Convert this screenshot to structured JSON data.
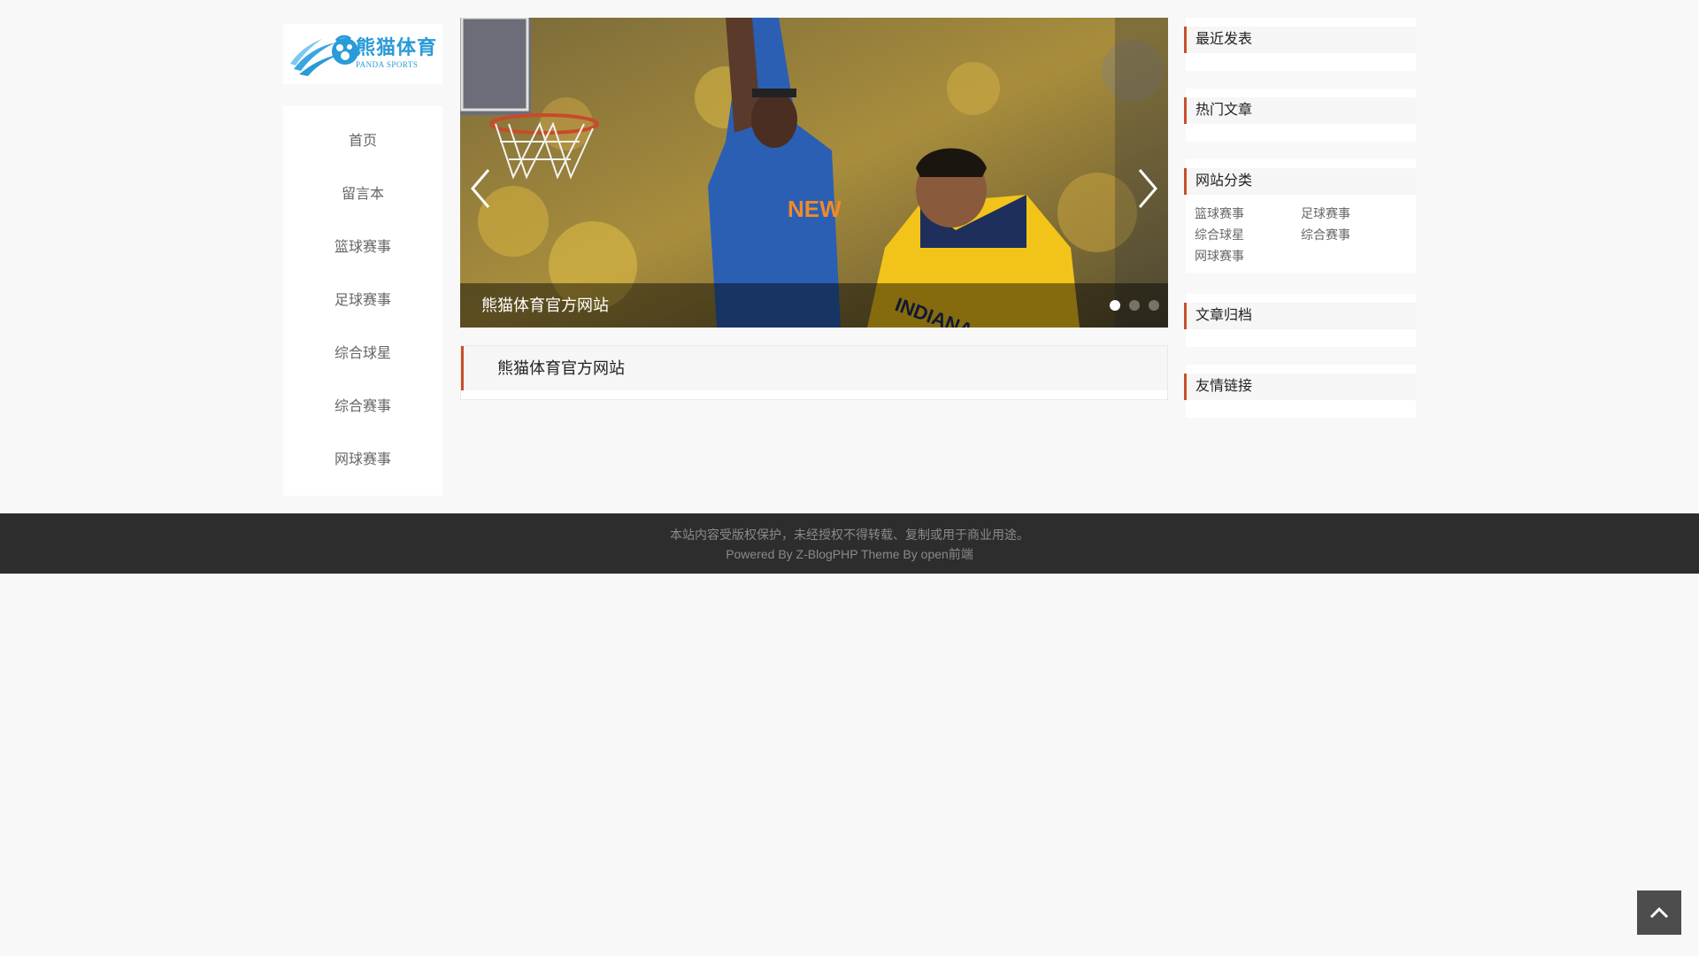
{
  "logo": {
    "text_cn": "熊猫体育",
    "text_en": "PANDA SPORTS",
    "brand_color": "#2a9ad8"
  },
  "nav": {
    "items": [
      {
        "label": "首页"
      },
      {
        "label": "留言本"
      },
      {
        "label": "篮球赛事"
      },
      {
        "label": "足球赛事"
      },
      {
        "label": "综合球星"
      },
      {
        "label": "综合赛事"
      },
      {
        "label": "网球赛事"
      }
    ]
  },
  "slider": {
    "caption": "熊猫体育官方网站",
    "prev_icon": "chevron-left-icon",
    "next_icon": "chevron-right-icon",
    "dots": 3,
    "active_dot": 1
  },
  "article": {
    "title": "熊猫体育官方网站"
  },
  "sidebar": {
    "accent_color": "#c6502b",
    "recent": {
      "title": "最近发表"
    },
    "hot": {
      "title": "热门文章"
    },
    "categories": {
      "title": "网站分类",
      "items": [
        {
          "label": "篮球赛事"
        },
        {
          "label": "足球赛事"
        },
        {
          "label": "综合球星"
        },
        {
          "label": "综合赛事"
        },
        {
          "label": "网球赛事"
        }
      ]
    },
    "archive": {
      "title": "文章归档"
    },
    "links": {
      "title": "友情链接"
    }
  },
  "footer": {
    "line1": "本站内容受版权保护，未经授权不得转载、复制或用于商业用途。",
    "line2": "Powered By Z-BlogPHP Theme By open前端"
  },
  "back_to_top": {
    "icon": "chevron-up-icon"
  }
}
